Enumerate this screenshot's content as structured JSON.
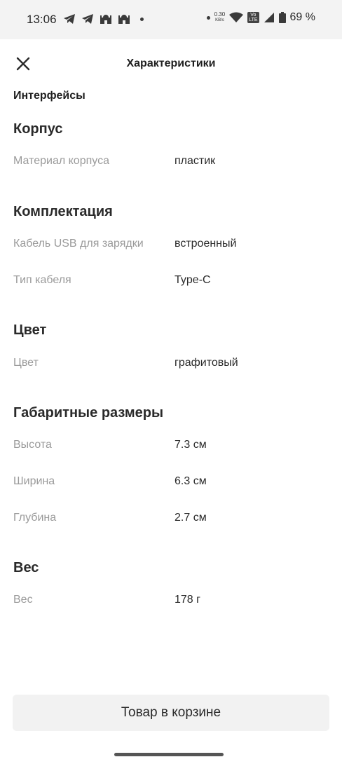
{
  "status": {
    "time": "13:06",
    "net_speed_value": "0.30",
    "net_speed_unit": "KB/s",
    "volte_top": "Vo",
    "volte_bottom": "LTE",
    "battery": "69 %"
  },
  "header": {
    "title": "Характеристики",
    "close_icon": "close-icon"
  },
  "subheading": "Интерфейсы",
  "sections": [
    {
      "title": "Корпус",
      "rows": [
        {
          "label": "Материал корпуса",
          "value": "пластик"
        }
      ]
    },
    {
      "title": "Комплектация",
      "rows": [
        {
          "label": "Кабель USB для зарядки",
          "value": "встроенный"
        },
        {
          "label": "Тип кабеля",
          "value": "Type-C"
        }
      ]
    },
    {
      "title": "Цвет",
      "rows": [
        {
          "label": "Цвет",
          "value": "графитовый"
        }
      ]
    },
    {
      "title": "Габаритные размеры",
      "rows": [
        {
          "label": "Высота",
          "value": "7.3 см"
        },
        {
          "label": "Ширина",
          "value": "6.3 см"
        },
        {
          "label": "Глубина",
          "value": "2.7 см"
        }
      ]
    },
    {
      "title": "Вес",
      "rows": [
        {
          "label": "Вес",
          "value": "178 г"
        }
      ]
    }
  ],
  "bottom": {
    "cart_button_label": "Товар в корзине"
  }
}
